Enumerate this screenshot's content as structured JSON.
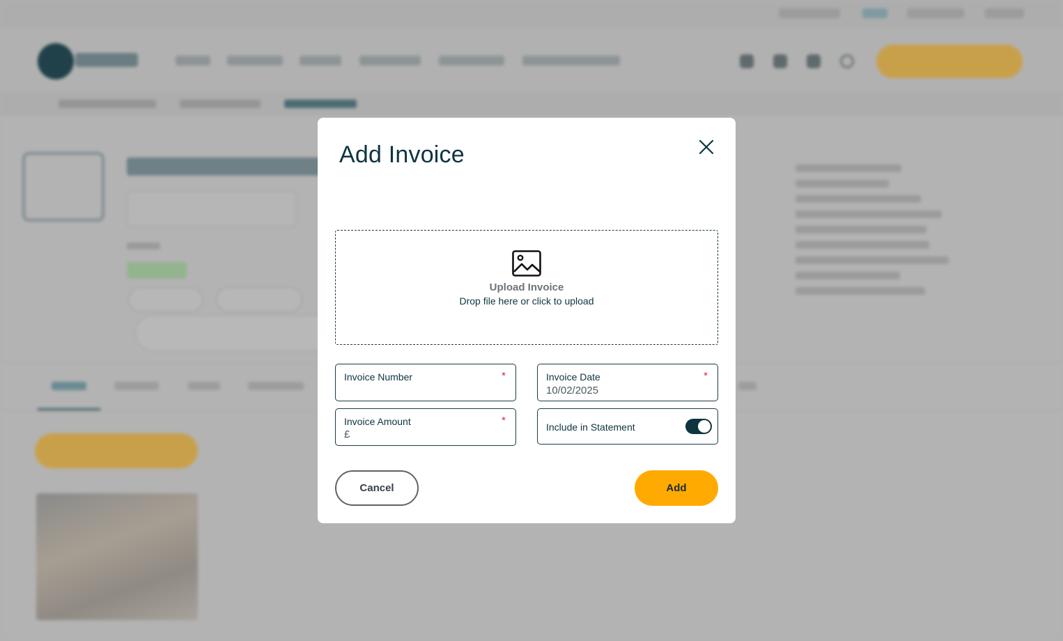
{
  "modal": {
    "title": "Add Invoice",
    "subtitle": "",
    "upload": {
      "title": "Upload Invoice",
      "hint": "Drop file here or click to upload"
    },
    "fields": {
      "invoice_number": {
        "label": "Invoice Number",
        "required_mark": "*",
        "value": ""
      },
      "invoice_date": {
        "label": "Invoice Date",
        "required_mark": "*",
        "value": "10/02/2025"
      },
      "invoice_amount": {
        "label": "Invoice Amount",
        "required_mark": "*",
        "prefix": "£",
        "value": ""
      },
      "include_in_statement": {
        "label": "Include in Statement",
        "checked": true
      }
    },
    "buttons": {
      "cancel": "Cancel",
      "add": "Add"
    }
  },
  "colors": {
    "primary_dark": "#0e3440",
    "accent_orange": "#ffaa00",
    "required_red": "#c8323c",
    "overlay_gray": "#b3b3b3"
  },
  "icons": {
    "close": "close-icon",
    "upload": "image-icon"
  }
}
